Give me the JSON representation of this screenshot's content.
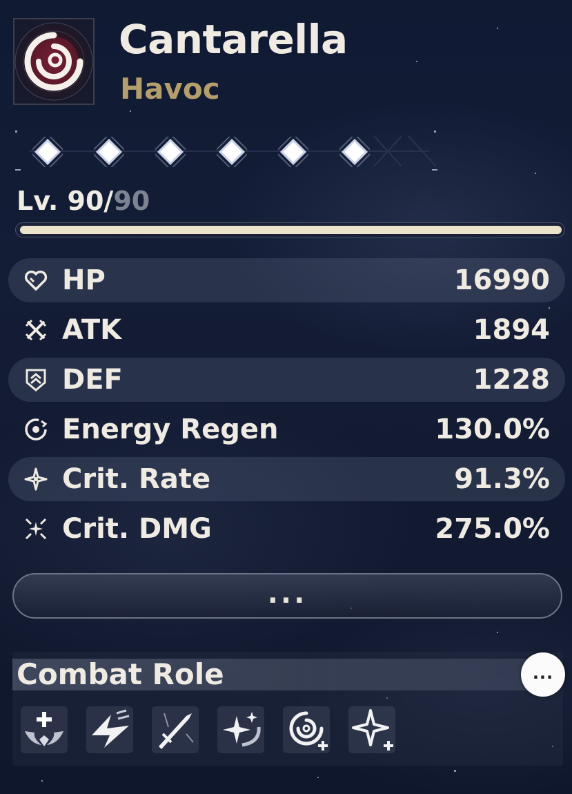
{
  "character": {
    "name": "Cantarella",
    "element": "Havoc",
    "element_color": "#b49f6c",
    "emblem_icon": "havoc-spiral-icon"
  },
  "sequence": {
    "nodes": [
      {
        "icon": "sequence-diamond-icon",
        "unlocked": true
      },
      {
        "icon": "sequence-diamond-icon",
        "unlocked": true
      },
      {
        "icon": "sequence-diamond-icon",
        "unlocked": true
      },
      {
        "icon": "sequence-diamond-icon",
        "unlocked": true
      },
      {
        "icon": "sequence-diamond-icon",
        "unlocked": true
      },
      {
        "icon": "sequence-diamond-icon",
        "unlocked": true
      }
    ]
  },
  "level": {
    "prefix": "Lv. 90/",
    "max": "90",
    "progress": 1.0
  },
  "stats": [
    {
      "icon": "hp-heart-icon",
      "label": "HP",
      "value": "16990"
    },
    {
      "icon": "atk-swords-icon",
      "label": "ATK",
      "value": "1894"
    },
    {
      "icon": "def-shield-icon",
      "label": "DEF",
      "value": "1228"
    },
    {
      "icon": "energy-regen-icon",
      "label": "Energy Regen",
      "value": "130.0%"
    },
    {
      "icon": "crit-rate-icon",
      "label": "Crit. Rate",
      "value": "91.3%"
    },
    {
      "icon": "crit-dmg-icon",
      "label": "Crit. DMG",
      "value": "275.0%"
    }
  ],
  "more_button": {
    "label": "..."
  },
  "combat_role": {
    "title": "Combat Role",
    "more_label": "...",
    "roles": [
      {
        "icon": "healer-icon"
      },
      {
        "icon": "concerto-lightning-icon"
      },
      {
        "icon": "sword-skill-icon"
      },
      {
        "icon": "sparkle-swirl-icon"
      },
      {
        "icon": "havoc-spiral-plus-icon"
      },
      {
        "icon": "star-plus-icon"
      }
    ]
  },
  "colors": {
    "background": "#121a31",
    "text": "#efebe3",
    "level_fill": "#ebe4cb"
  }
}
